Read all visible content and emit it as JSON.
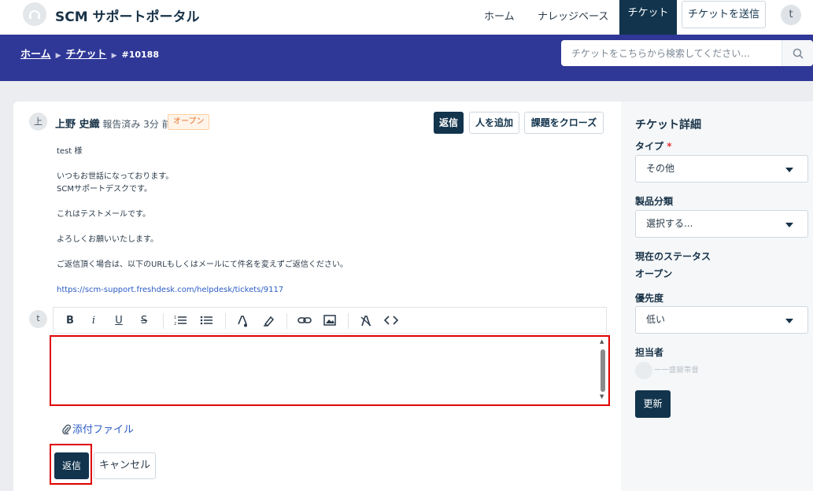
{
  "header": {
    "portal_title": "SCM サポートポータル",
    "nav": {
      "home": "ホーム",
      "knowledge_base": "ナレッジベース",
      "tickets": "チケット",
      "submit_ticket": "チケットを送信"
    },
    "user_initial": "t"
  },
  "banner": {
    "breadcrumb": {
      "home": "ホーム",
      "tickets": "チケット",
      "ticket_id": "#10188"
    },
    "search": {
      "placeholder": "チケットをこちらから検索してください..."
    }
  },
  "ticket": {
    "requester_initial": "上",
    "requester_name": "上野 史織",
    "reported_text": "報告済み 3分 前",
    "status_badge": "オープン",
    "actions": {
      "reply": "返信",
      "add_people": "人を追加",
      "close_issue": "課題をクローズ"
    },
    "message": {
      "greeting": "test 様",
      "line1": "いつもお世話になっております。",
      "line2": "SCMサポートデスクです。",
      "line3": "これはテストメールです。",
      "line4": "よろしくお願いいたします。",
      "line5": "ご返信頂く場合は、以下のURLもしくはメールにて件名を変えずご返信ください。",
      "link": "https://scm-support.freshdesk.com/helpdesk/tickets/9117"
    }
  },
  "reply_editor": {
    "user_initial": "t",
    "toolbar": {
      "bold": "B",
      "italic": "i",
      "underline": "U",
      "strikethrough": "S"
    },
    "attach_label": "添付ファイル",
    "reply_button": "返信",
    "cancel_button": "キャンセル"
  },
  "sidebar": {
    "title": "チケット詳細",
    "type_label": "タイプ",
    "required_mark": "*",
    "type_value": "その他",
    "product_label": "製品分類",
    "product_value": "選択する...",
    "status_label": "現在のステータス",
    "status_value": "オープン",
    "priority_label": "優先度",
    "priority_value": "低い",
    "agent_label": "担当者",
    "agent_name": "一一盛腿帯督",
    "update_button": "更新"
  },
  "colors": {
    "banner": "#2f3897",
    "primary": "#12344d",
    "highlight_outline": "#e00000",
    "badge_orange": "#e86f25",
    "link_blue": "#2c5cc5"
  }
}
